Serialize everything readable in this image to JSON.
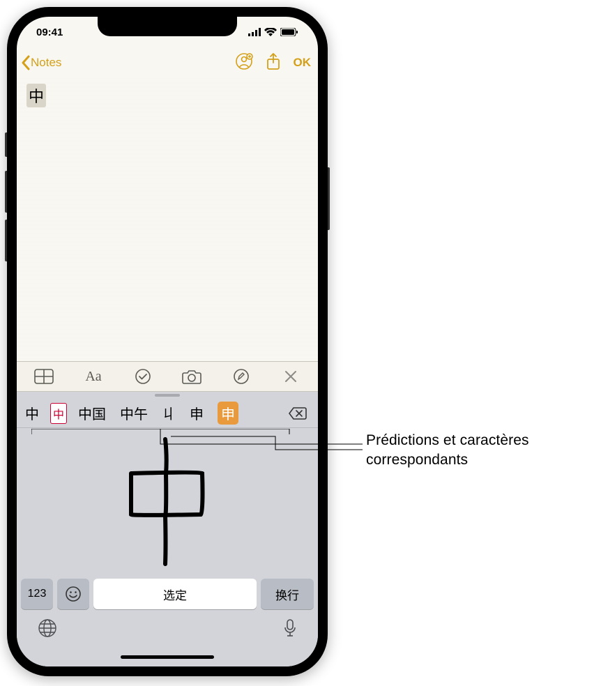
{
  "status_bar": {
    "time": "09:41"
  },
  "nav": {
    "back_label": "Notes",
    "done_label": "OK"
  },
  "note": {
    "content": "中"
  },
  "format_bar": {
    "icons": [
      "table-icon",
      "text-format-icon",
      "checklist-icon",
      "camera-icon",
      "markup-icon",
      "close-icon"
    ]
  },
  "candidates": {
    "items": [
      "中",
      "中",
      "中国",
      "中午",
      "丩",
      "申",
      "申"
    ]
  },
  "keyboard": {
    "numbers_label": "123",
    "select_label": "选定",
    "return_label": "换行"
  },
  "callout": {
    "line1": "Prédictions et caractères",
    "line2": "correspondants"
  }
}
